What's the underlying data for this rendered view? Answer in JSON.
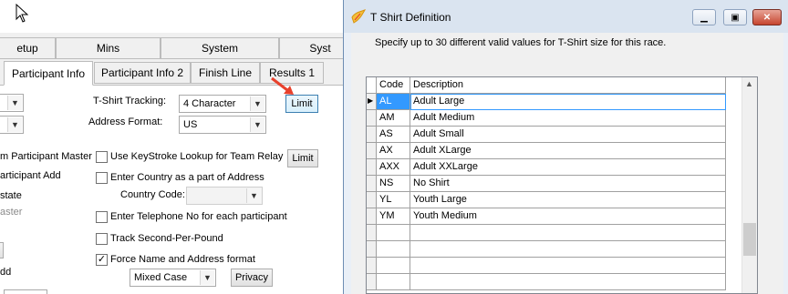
{
  "left_window": {
    "tabs_top": [
      "etup",
      "Mins",
      "System",
      "Syst"
    ],
    "tabs_bottom": [
      "Participant Info",
      "Participant Info 2",
      "Finish Line",
      "Results 1"
    ],
    "tshirt_tracking_label": "T-Shirt Tracking:",
    "tshirt_tracking_value": "4 Character",
    "limit_label": "Limit",
    "address_format_label": "Address Format:",
    "address_format_value": "US",
    "frag_team_master": "m Participant Master",
    "frag_participant_add": "articipant Add",
    "frag_state": "state",
    "frag_aster": "aster",
    "frag_dd": "dd",
    "keystroke_lookup_label": "Use KeyStroke Lookup for Team Relay",
    "keystroke_limit_label": "Limit",
    "enter_country_label": "Enter Country as a part of Address",
    "country_code_label": "Country Code:",
    "country_code_value": "",
    "enter_telephone_label": "Enter Telephone No for each participant",
    "track_second_label": "Track Second-Per-Pound",
    "force_name_label": "Force Name and Address format",
    "force_name_checked": "✓",
    "case_value": "Mixed Case",
    "privacy_label": "Privacy"
  },
  "dialog": {
    "title": "T Shirt Definition",
    "description": "Specify up to 30 different valid values for T-Shirt size for this race.",
    "columns": {
      "code": "Code",
      "description": "Description"
    },
    "current_row_marker": "▶",
    "rows": [
      {
        "code": "AL",
        "description": "Adult Large"
      },
      {
        "code": "AM",
        "description": "Adult Medium"
      },
      {
        "code": "AS",
        "description": "Adult Small"
      },
      {
        "code": "AX",
        "description": "Adult XLarge"
      },
      {
        "code": "AXX",
        "description": "Adult XXLarge"
      },
      {
        "code": "NS",
        "description": "No Shirt"
      },
      {
        "code": "YL",
        "description": "Youth Large"
      },
      {
        "code": "YM",
        "description": "Youth Medium"
      }
    ]
  },
  "colors": {
    "accent_selection": "#3399ff",
    "arrow_red": "#e8412c",
    "dialog_frame": "#dae4f0"
  },
  "icons": [
    "cursor-icon",
    "red-arrow-icon",
    "app-icon",
    "minimize-icon",
    "maximize-icon",
    "close-icon",
    "chevron-down-icon",
    "scroll-up-icon"
  ]
}
